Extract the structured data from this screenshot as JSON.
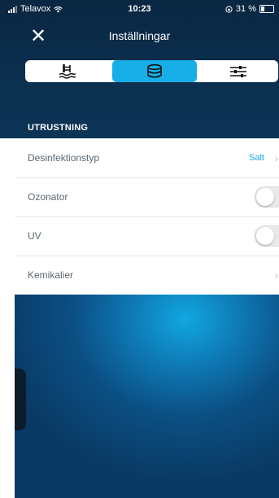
{
  "status_bar": {
    "carrier": "Telavox",
    "time": "10:23",
    "battery": "31 %"
  },
  "header": {
    "title": "Inställningar",
    "close_glyph": "✕"
  },
  "segmented_control": {
    "selected_index": 1,
    "tabs": [
      {
        "icon": "pool-ladder-icon"
      },
      {
        "icon": "coins-stack-icon"
      },
      {
        "icon": "sliders-icon"
      }
    ]
  },
  "section": {
    "title": "UTRUSTNING"
  },
  "settings": {
    "rows": [
      {
        "label": "Desinfektionstyp",
        "value": "Salt",
        "type": "disclosure"
      },
      {
        "label": "Ozonator",
        "type": "toggle",
        "on": false
      },
      {
        "label": "UV",
        "type": "toggle",
        "on": false
      },
      {
        "label": "Kemikalier",
        "type": "disclosure"
      }
    ],
    "chevron": "›"
  },
  "colors": {
    "accent": "#17aee8",
    "header_bg": "#0b2f4f",
    "value_text": "#17a9e3"
  }
}
